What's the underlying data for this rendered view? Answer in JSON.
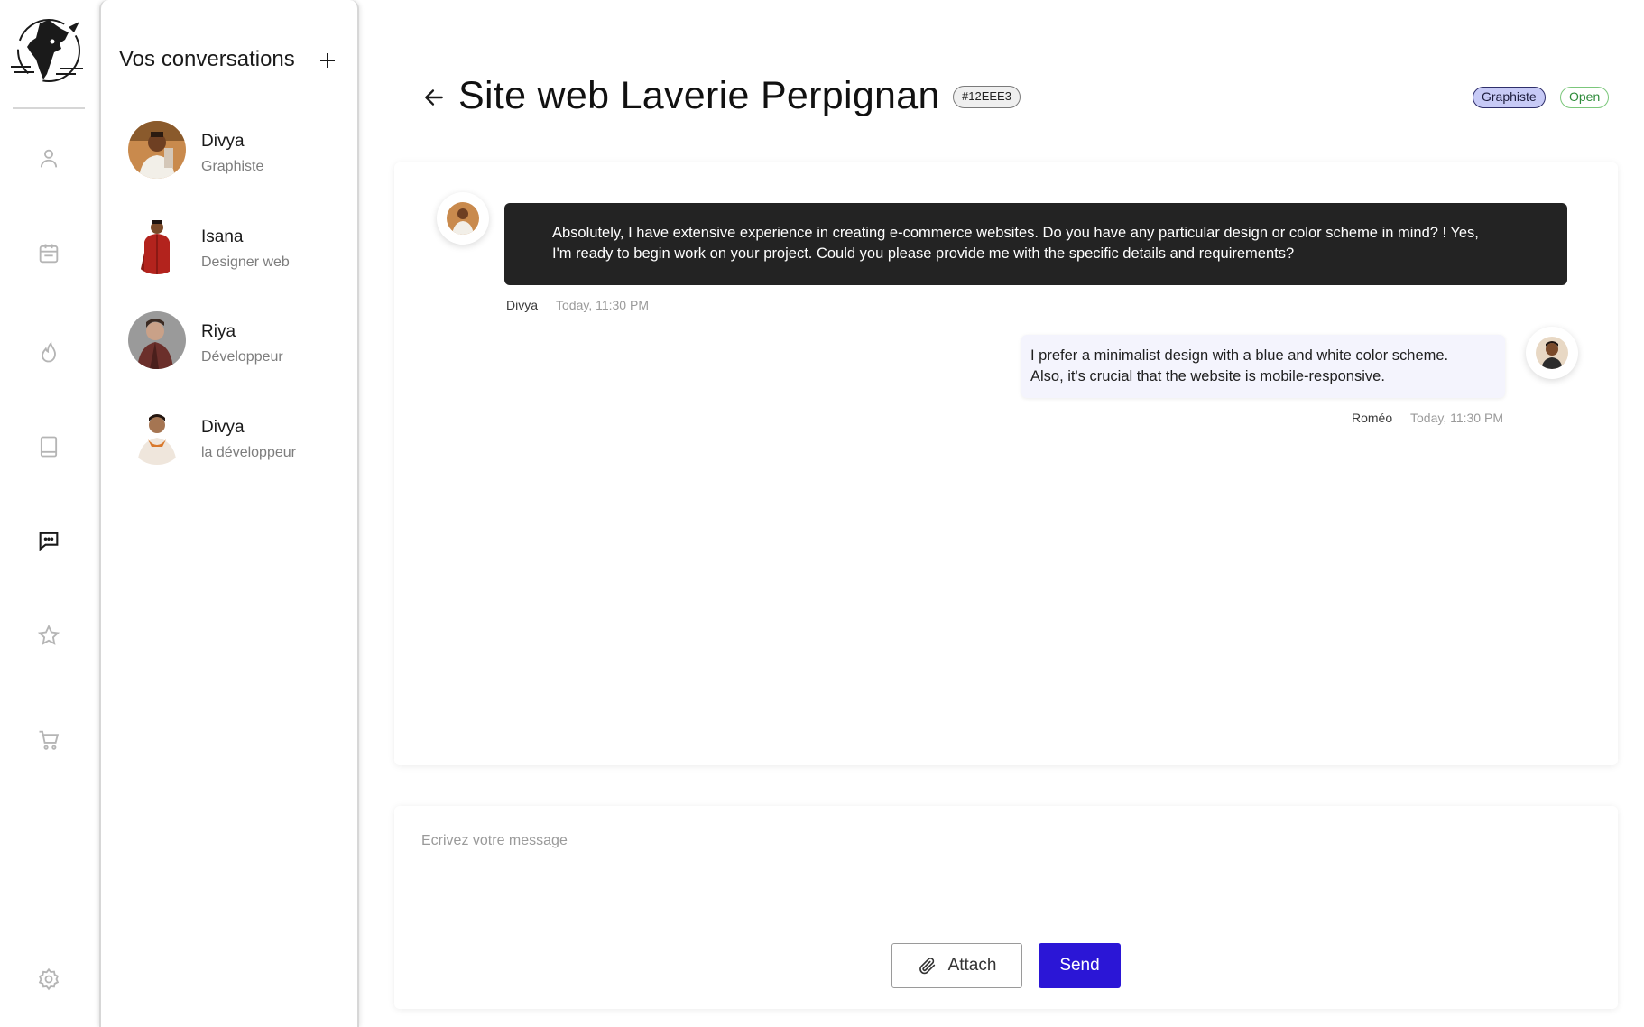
{
  "rail": {
    "icons": [
      "user-icon",
      "calendar-icon",
      "flame-icon",
      "book-icon",
      "chat-icon",
      "star-icon",
      "cart-icon",
      "settings-icon"
    ],
    "active": "chat-icon",
    "active_color": "#1a1a1a",
    "inactive_color": "#b5b5b5"
  },
  "conversations": {
    "title": "Vos conversations",
    "items": [
      {
        "name": "Divya",
        "role": "Graphiste"
      },
      {
        "name": "Isana",
        "role": "Designer web"
      },
      {
        "name": "Riya",
        "role": "Développeur"
      },
      {
        "name": "Divya",
        "role": "la développeur"
      }
    ]
  },
  "header": {
    "title": "Site web Laverie Perpignan",
    "ticket_id": "#12EEE3",
    "role_badge": "Graphiste",
    "status_badge": "Open"
  },
  "messages": [
    {
      "author": "Divya",
      "time": "Today, 11:30 PM",
      "line1": "Absolutely, I have extensive experience in creating e-commerce websites. Do you have any particular design or color scheme in mind? ! Yes,",
      "line2": "I'm ready to begin work on your project. Could you please provide me with the specific details and requirements?"
    },
    {
      "author": "Roméo",
      "time": "Today, 11:30 PM",
      "line1": "I prefer a minimalist design with a blue and white color scheme.",
      "line2": "Also, it's crucial that the website is mobile-responsive."
    }
  ],
  "composer": {
    "placeholder": "Ecrivez votre message",
    "attach_label": "Attach",
    "send_label": "Send"
  },
  "colors": {
    "accent": "#2b16d6",
    "dark_bubble": "#232323",
    "light_bubble": "#f4f4fd",
    "role_badge_bg": "#c7caf6",
    "status_green": "#2e8b3a"
  }
}
